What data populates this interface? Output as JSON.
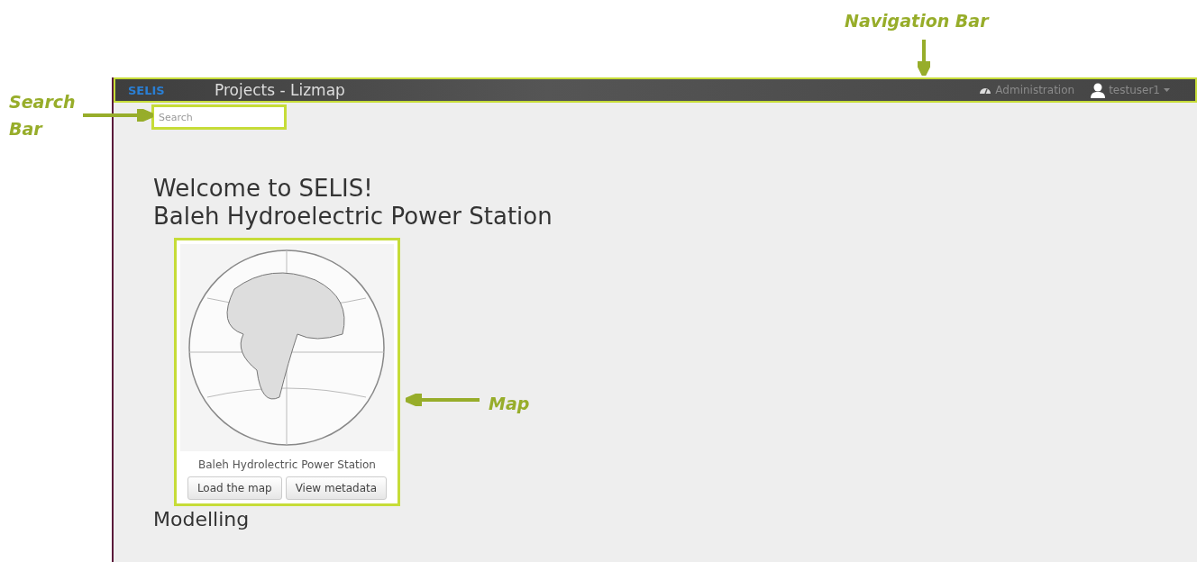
{
  "annotations": [
    {
      "label": "Navigation Bar",
      "kind": "down"
    },
    {
      "label": "Search Bar",
      "kind": "right"
    },
    {
      "label": "Map",
      "kind": "left"
    }
  ],
  "navbar": {
    "logo": "SELIS",
    "title": "Projects - Lizmap",
    "admin": "Administration",
    "user": "testuser1"
  },
  "search": {
    "placeholder": "Search"
  },
  "headings": [
    "Welcome to SELIS!",
    "Baleh Hydroelectric Power Station"
  ],
  "projects": [
    {
      "title": "Baleh Hydrolectric Power Station",
      "buttons": [
        "Load the map",
        "View metadata"
      ]
    }
  ],
  "next_heading": "Modelling"
}
